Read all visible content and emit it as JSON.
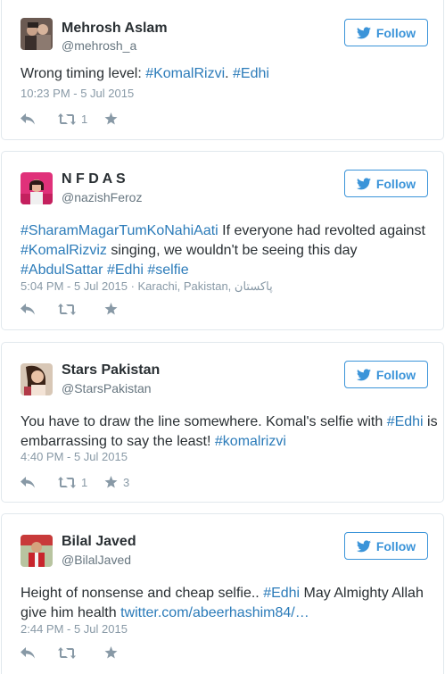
{
  "follow_label": "Follow",
  "tweets": [
    {
      "name": "Mehrosh Aslam",
      "handle": "@mehrosh_a",
      "text_parts": [
        "Wrong timing level: ",
        "#KomalRizvi",
        ". ",
        "#Edhi"
      ],
      "meta": "10:23 PM - 5 Jul 2015",
      "retweets": "1",
      "favorites": ""
    },
    {
      "name": "N F D A S",
      "handle": "@nazishFeroz",
      "text_parts": [
        "#SharamMagarTumKoNahiAati",
        " If everyone had revolted against ",
        "#KomalRizviz",
        " singing, we wouldn't be seeing this day ",
        "#AbdulSattar",
        " ",
        "#Edhi",
        " ",
        "#selfie"
      ],
      "meta": "5:04 PM - 5 Jul 2015 · Karachi, Pakistan, پاکستان",
      "retweets": "",
      "favorites": ""
    },
    {
      "name": "Stars Pakistan",
      "handle": "@StarsPakistan",
      "text_parts": [
        "You have to draw the line somewhere. Komal's selfie with ",
        "#Edhi",
        " is embarrassing to say the least! ",
        "#komalrizvi"
      ],
      "meta": "4:40 PM - 5 Jul 2015",
      "retweets": "1",
      "favorites": "3"
    },
    {
      "name": "Bilal Javed",
      "handle": "@BilalJaved",
      "text_parts": [
        "Height of nonsense and cheap selfie.. ",
        "#Edhi",
        " May Almighty Allah give him health ",
        "twitter.com/abeerhashim84/…"
      ],
      "meta": "2:44 PM - 5 Jul 2015",
      "retweets": "",
      "favorites": ""
    }
  ],
  "icons": {
    "follow": "twitter-bird-icon",
    "reply": "reply-arrow-icon",
    "retweet": "retweet-icon",
    "favorite": "star-icon"
  },
  "colors": {
    "link": "#2b7bb9",
    "follow": "#3b94d9",
    "muted": "#8899a6",
    "text": "#292f33"
  }
}
